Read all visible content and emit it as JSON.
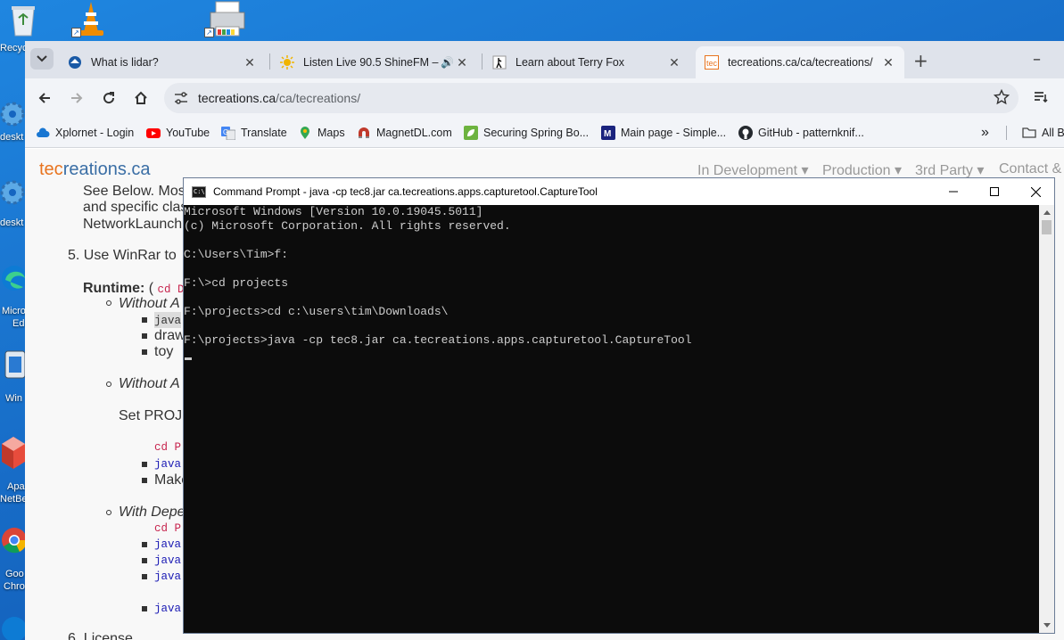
{
  "desktop": {
    "icons": [
      {
        "name": "recycle-bin",
        "label": "Recycl"
      },
      {
        "name": "vlc",
        "label": ""
      },
      {
        "name": "printer-app",
        "label": ""
      },
      {
        "name": "desktop-settings-1",
        "label": "deskt"
      },
      {
        "name": "desktop-settings-2",
        "label": "deskt"
      },
      {
        "name": "microsoft-edge",
        "label": "Micro\nEd"
      },
      {
        "name": "windows-app",
        "label": "Win"
      },
      {
        "name": "apache-netbeans",
        "label": "Apa\nNetBe"
      },
      {
        "name": "google-chrome",
        "label": "Goo\nChro"
      }
    ],
    "labels": {
      "recycle": "Recycl",
      "deskt1": "deskt",
      "deskt2": "deskt",
      "edge1": "Micro",
      "edge2": "Ed",
      "win": "Win",
      "netbeans1": "Apa",
      "netbeans2": "NetBe",
      "chrome1": "Goo",
      "chrome2": "Chro"
    }
  },
  "browser": {
    "tabs": [
      {
        "label": "What is lidar?",
        "close": "✕"
      },
      {
        "label": "Listen Live 90.5 ShineFM – S",
        "close": "✕"
      },
      {
        "label": "Learn about Terry Fox",
        "close": "✕"
      },
      {
        "label": "tecreations.ca/ca/tecreations/",
        "close": "✕"
      }
    ],
    "new_tab": "+",
    "window_minimize": "–",
    "address": {
      "host": "tecreations.ca",
      "path": "/ca/tecreations/"
    },
    "bookmarks": [
      {
        "label": "Xplornet - Login",
        "color": "#1976d2"
      },
      {
        "label": "YouTube",
        "color": "#ff0000"
      },
      {
        "label": "Translate",
        "color": "#4285f4"
      },
      {
        "label": "Maps",
        "color": "#34a853"
      },
      {
        "label": "MagnetDL.com",
        "color": "#c0392b"
      },
      {
        "label": "Securing Spring Bo...",
        "color": "#6db33f"
      },
      {
        "label": "Main page - Simple...",
        "color": "#1a237e"
      },
      {
        "label": "GitHub - patternknif...",
        "color": "#24292e"
      }
    ],
    "bookmarks_more": "»",
    "all_bookmarks": "All B"
  },
  "page": {
    "logo_tec": "tec",
    "logo_rest": "reations.ca",
    "nav": [
      {
        "label": "In Development ▾"
      },
      {
        "label": "Production ▾"
      },
      {
        "label": "3rd Party ▾"
      },
      {
        "label": "Contact &"
      }
    ],
    "body": {
      "line1": "See Below. Mos",
      "line2": "and specific clas",
      "line3": "NetworkLaunch",
      "step5": "5.  Use WinRar to",
      "runtime_label": "Runtime:",
      "runtime_paren": " ( ",
      "runtime_code": "cd D",
      "without1": "Without A",
      "java1": "java",
      "draw": "draw",
      "toy": "toy",
      "without2": "Without A",
      "setproj": "Set PROJ",
      "cdp1": "cd P",
      "java2": "java",
      "make": "Make",
      "withdep": "With Depe",
      "cdp2": "cd P",
      "java3": "java",
      "java4": "java",
      "java5": "java",
      "java6": "java",
      "step6": "6.  License"
    }
  },
  "cmd": {
    "title": "Command Prompt - java  -cp tec8.jar ca.tecreations.apps.capturetool.CaptureTool",
    "lines": [
      "Microsoft Windows [Version 10.0.19045.5011]",
      "(c) Microsoft Corporation. All rights reserved.",
      "",
      "C:\\Users\\Tim>f:",
      "",
      "F:\\>cd projects",
      "",
      "F:\\projects>cd c:\\users\\tim\\Downloads\\",
      "",
      "F:\\projects>java -cp tec8.jar ca.tecreations.apps.capturetool.CaptureTool"
    ]
  }
}
